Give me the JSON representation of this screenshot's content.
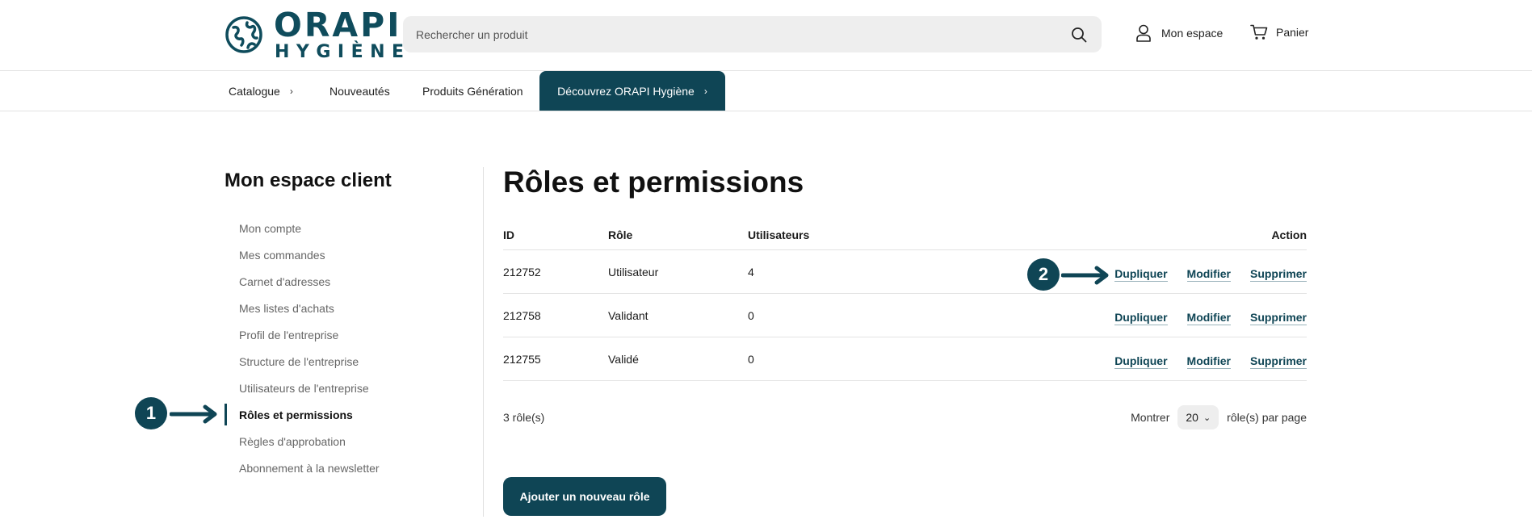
{
  "brand": {
    "name": "ORAPI",
    "subname": "HYGIÈNE",
    "color": "#0f4555"
  },
  "search": {
    "placeholder": "Rechercher un produit",
    "icon": "search-icon"
  },
  "header": {
    "account_label": "Mon espace",
    "cart_label": "Panier"
  },
  "nav": {
    "items": [
      {
        "label": "Catalogue",
        "has_chevron": true
      },
      {
        "label": "Nouveautés"
      },
      {
        "label": "Produits Génération"
      }
    ],
    "cta_label": "Découvrez ORAPI Hygiène"
  },
  "sidebar": {
    "title": "Mon espace client",
    "items": [
      {
        "label": "Mon compte"
      },
      {
        "label": "Mes commandes"
      },
      {
        "label": "Carnet d'adresses"
      },
      {
        "label": "Mes listes d'achats"
      },
      {
        "label": "Profil de l'entreprise"
      },
      {
        "label": "Structure de l'entreprise"
      },
      {
        "label": "Utilisateurs de l'entreprise"
      },
      {
        "label": "Rôles et permissions",
        "active": true
      },
      {
        "label": "Règles d'approbation"
      },
      {
        "label": "Abonnement à la newsletter"
      }
    ]
  },
  "main": {
    "title": "Rôles et permissions",
    "columns": {
      "id": "ID",
      "role": "Rôle",
      "users": "Utilisateurs",
      "action": "Action"
    },
    "rows": [
      {
        "id": "212752",
        "role": "Utilisateur",
        "users": "4"
      },
      {
        "id": "212758",
        "role": "Validant",
        "users": "0"
      },
      {
        "id": "212755",
        "role": "Validé",
        "users": "0"
      }
    ],
    "actions": {
      "duplicate": "Dupliquer",
      "edit": "Modifier",
      "delete": "Supprimer"
    },
    "count_label": "3 rôle(s)",
    "show_label": "Montrer",
    "per_page_value": "20",
    "per_page_suffix": "rôle(s) par page",
    "add_button": "Ajouter un nouveau rôle"
  },
  "annotations": {
    "badge1": "1",
    "badge2": "2"
  }
}
